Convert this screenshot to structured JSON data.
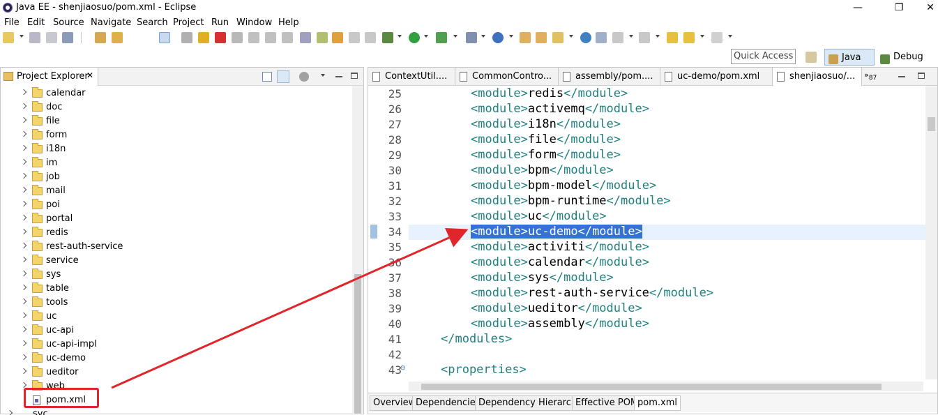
{
  "window": {
    "title": "Java EE - shenjiaosuo/pom.xml - Eclipse",
    "min": "—",
    "max": "❐",
    "close": "✕"
  },
  "menu": [
    "File",
    "Edit",
    "Source",
    "Navigate",
    "Search",
    "Project",
    "Run",
    "Window",
    "Help"
  ],
  "quick_access": {
    "placeholder": "Quick Access"
  },
  "perspectives": {
    "javaee": "Java EE",
    "debug": "Debug"
  },
  "explorer": {
    "title": "Project Explorer",
    "close": "✕",
    "items": [
      "calendar",
      "doc",
      "file",
      "form",
      "i18n",
      "im",
      "job",
      "mail",
      "poi",
      "portal",
      "redis",
      "rest-auth-service",
      "service",
      "sys",
      "table",
      "tools",
      "uc",
      "uc-api",
      "uc-api-impl",
      "uc-demo",
      "ueditor",
      "web"
    ],
    "selected_file": "pom.xml",
    "partial_bottom": "svc"
  },
  "editor": {
    "tabs": [
      "ContextUtil....",
      "CommonContro...",
      "assembly/pom....",
      "uc-demo/pom.xml",
      "shenjiaosuo/..."
    ],
    "more_tabs": "87",
    "lines": [
      {
        "n": "25",
        "indent": 2,
        "tag": "module",
        "val": "redis"
      },
      {
        "n": "26",
        "indent": 2,
        "tag": "module",
        "val": "activemq"
      },
      {
        "n": "27",
        "indent": 2,
        "tag": "module",
        "val": "i18n"
      },
      {
        "n": "28",
        "indent": 2,
        "tag": "module",
        "val": "file"
      },
      {
        "n": "29",
        "indent": 2,
        "tag": "module",
        "val": "form"
      },
      {
        "n": "30",
        "indent": 2,
        "tag": "module",
        "val": "bpm"
      },
      {
        "n": "31",
        "indent": 2,
        "tag": "module",
        "val": "bpm-model"
      },
      {
        "n": "32",
        "indent": 2,
        "tag": "module",
        "val": "bpm-runtime"
      },
      {
        "n": "33",
        "indent": 2,
        "tag": "module",
        "val": "uc"
      },
      {
        "n": "34",
        "indent": 2,
        "tag": "module",
        "val": "uc-demo",
        "selected": true
      },
      {
        "n": "35",
        "indent": 2,
        "tag": "module",
        "val": "activiti"
      },
      {
        "n": "36",
        "indent": 2,
        "tag": "module",
        "val": "calendar"
      },
      {
        "n": "37",
        "indent": 2,
        "tag": "module",
        "val": "sys"
      },
      {
        "n": "38",
        "indent": 2,
        "tag": "module",
        "val": "rest-auth-service"
      },
      {
        "n": "39",
        "indent": 2,
        "tag": "module",
        "val": "ueditor"
      },
      {
        "n": "40",
        "indent": 2,
        "tag": "module",
        "val": "assembly"
      },
      {
        "n": "41",
        "indent": 1,
        "raw": "</modules>"
      },
      {
        "n": "42",
        "indent": 0,
        "raw": ""
      },
      {
        "n": "43",
        "indent": 1,
        "raw": "<properties>",
        "fold": "⊖"
      }
    ],
    "bottom_tabs": [
      "Overview",
      "Dependencies",
      "Dependency Hierarchy",
      "Effective POM",
      "pom.xml"
    ],
    "active_bottom_tab": "pom.xml"
  },
  "colors": {
    "tag": "#208080",
    "selection": "#3373d6",
    "current_line": "#e8f2fe",
    "annotation": "#e0262a"
  }
}
